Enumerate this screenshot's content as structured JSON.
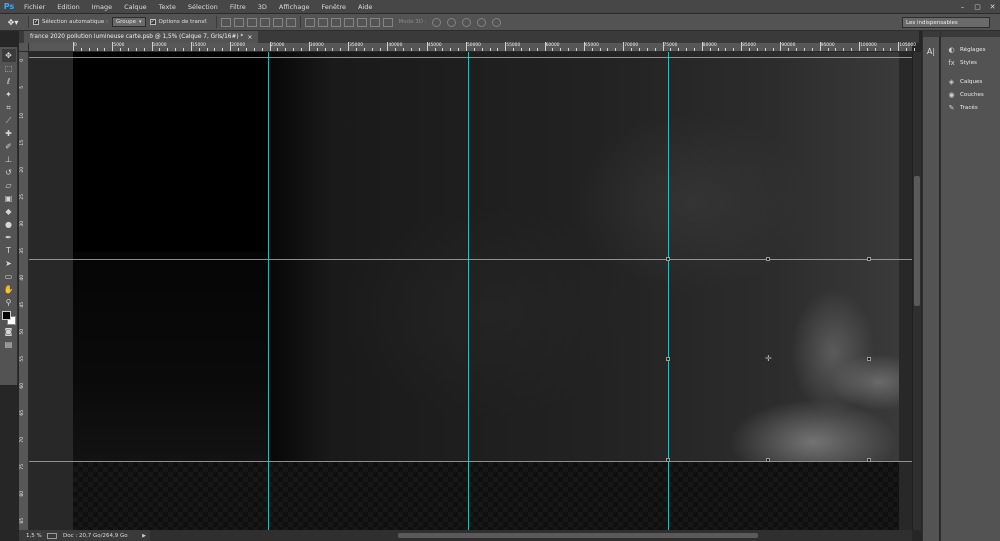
{
  "app": {
    "logo": "Ps"
  },
  "menu": [
    "Fichier",
    "Edition",
    "Image",
    "Calque",
    "Texte",
    "Sélection",
    "Filtre",
    "3D",
    "Affichage",
    "Fenêtre",
    "Aide"
  ],
  "options": {
    "auto_select_label": "Sélection automatique :",
    "auto_select_checked": true,
    "auto_select_value": "Groupe",
    "transform_label": "Options de transf.",
    "transform_checked": true,
    "mode3d_label": "Mode 3D :",
    "workspace": "Les indispensables"
  },
  "document": {
    "tab_title": "france 2020 pollution lumineuse carte.psb @ 1,5% (Calque 7, Gris/16#) *",
    "zoom": "1,5 %",
    "doc_info": "Doc : 20,7 Go/264,9 Go"
  },
  "ruler": {
    "top_labels": [
      "0",
      "5000",
      "10000",
      "15000",
      "20000",
      "25000",
      "30000",
      "35000",
      "40000",
      "45000",
      "50000",
      "55000",
      "60000",
      "65000",
      "70000",
      "75000",
      "80000",
      "85000",
      "90000",
      "95000",
      "100000",
      "105000"
    ],
    "left_labels": [
      "0",
      "5",
      "10",
      "15",
      "20",
      "25",
      "30",
      "35",
      "40",
      "45",
      "50",
      "55",
      "60",
      "65",
      "70",
      "75",
      "80",
      "85"
    ]
  },
  "panels": [
    {
      "icon": "adjustments-icon",
      "glyph": "◐",
      "label": "Réglages"
    },
    {
      "icon": "styles-icon",
      "glyph": "fx",
      "label": "Styles"
    },
    {
      "icon": "layers-icon",
      "glyph": "◈",
      "label": "Calques"
    },
    {
      "icon": "channels-icon",
      "glyph": "◉",
      "label": "Couches"
    },
    {
      "icon": "paths-icon",
      "glyph": "✎",
      "label": "Tracés"
    }
  ],
  "tools": [
    {
      "name": "move-tool-icon",
      "glyph": "✥"
    },
    {
      "name": "marquee-tool-icon",
      "glyph": "⬚"
    },
    {
      "name": "lasso-tool-icon",
      "glyph": "ℓ"
    },
    {
      "name": "quick-select-tool-icon",
      "glyph": "✦"
    },
    {
      "name": "crop-tool-icon",
      "glyph": "⌗"
    },
    {
      "name": "eyedropper-tool-icon",
      "glyph": "⟋"
    },
    {
      "name": "healing-brush-tool-icon",
      "glyph": "✚"
    },
    {
      "name": "brush-tool-icon",
      "glyph": "✐"
    },
    {
      "name": "clone-stamp-tool-icon",
      "glyph": "⊥"
    },
    {
      "name": "history-brush-tool-icon",
      "glyph": "↺"
    },
    {
      "name": "eraser-tool-icon",
      "glyph": "▱"
    },
    {
      "name": "gradient-tool-icon",
      "glyph": "▣"
    },
    {
      "name": "blur-tool-icon",
      "glyph": "◆"
    },
    {
      "name": "dodge-tool-icon",
      "glyph": "●"
    },
    {
      "name": "pen-tool-icon",
      "glyph": "✒"
    },
    {
      "name": "type-tool-icon",
      "glyph": "T"
    },
    {
      "name": "path-select-tool-icon",
      "glyph": "➤"
    },
    {
      "name": "rectangle-tool-icon",
      "glyph": "▭"
    },
    {
      "name": "hand-tool-icon",
      "glyph": "✋"
    },
    {
      "name": "zoom-tool-icon",
      "glyph": "⚲"
    }
  ],
  "colors": {
    "guide": "#3ad1d1",
    "foreground": "#000000",
    "background": "#ffffff",
    "logo": "#3fa9f5"
  }
}
